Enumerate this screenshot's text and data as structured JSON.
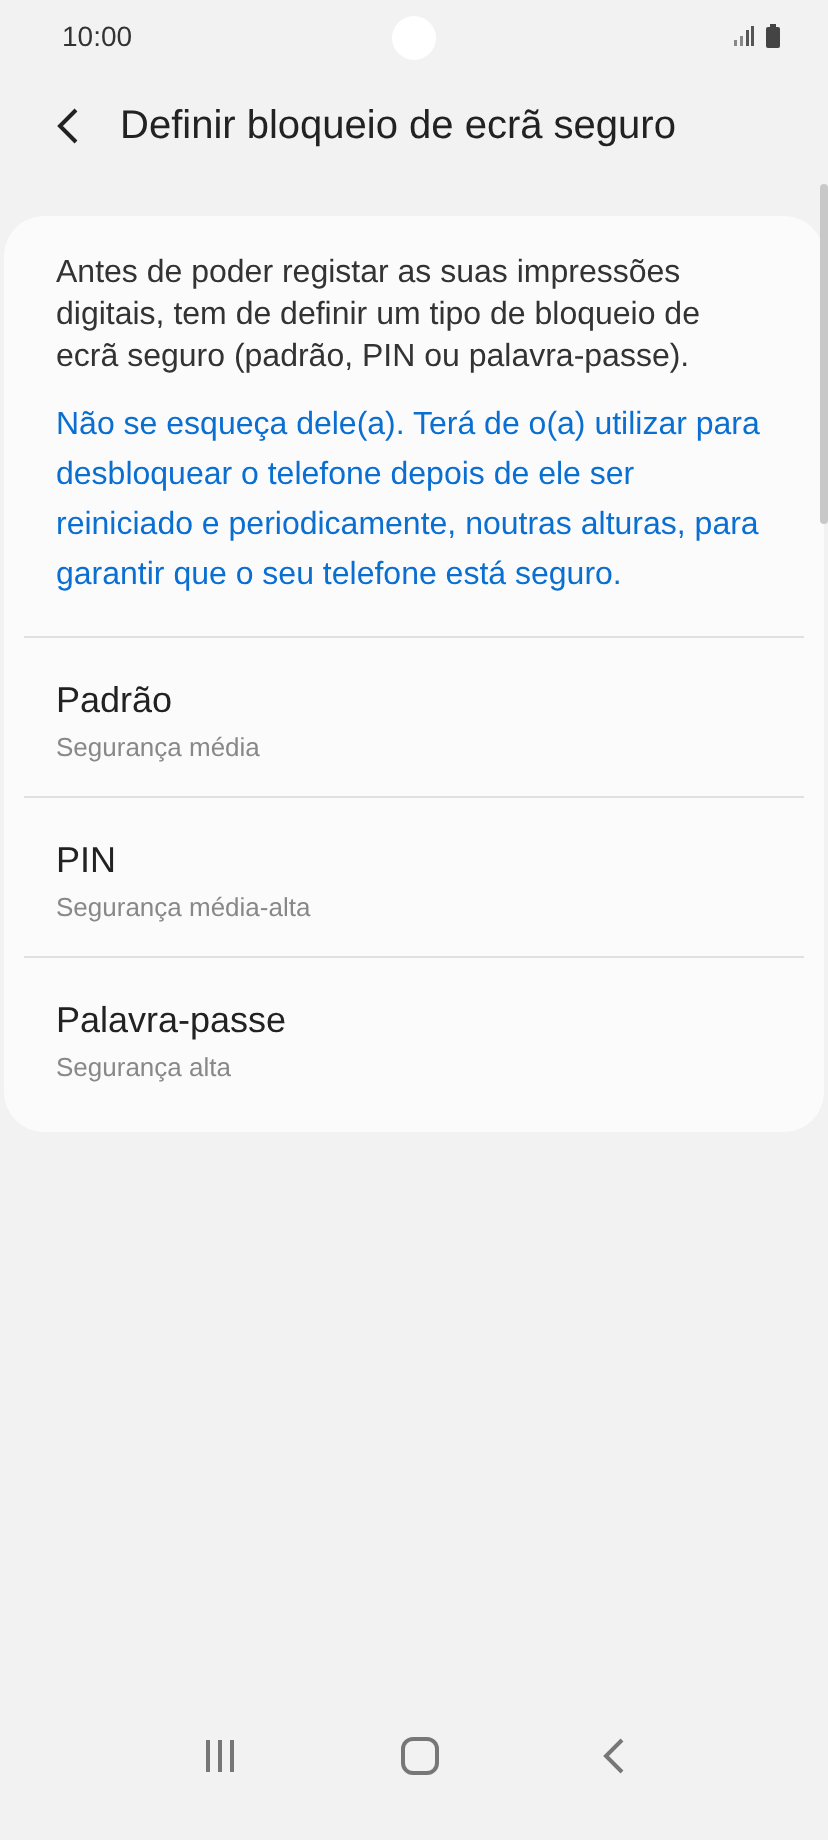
{
  "status_bar": {
    "time": "10:00"
  },
  "header": {
    "title": "Definir bloqueio de ecrã seguro"
  },
  "intro": "Antes de poder registar as suas impressões digitais, tem de definir um tipo de bloqueio de ecrã seguro (padrão, PIN ou palavra-passe).",
  "note": "Não se esqueça dele(a). Terá de o(a) utilizar para desbloquear o telefone depois de ele ser reiniciado e periodicamente, noutras alturas, para garantir que o seu telefone está seguro.",
  "options": [
    {
      "title": "Padrão",
      "subtitle": "Segurança média"
    },
    {
      "title": "PIN",
      "subtitle": "Segurança média-alta"
    },
    {
      "title": "Palavra-passe",
      "subtitle": "Segurança alta"
    }
  ]
}
